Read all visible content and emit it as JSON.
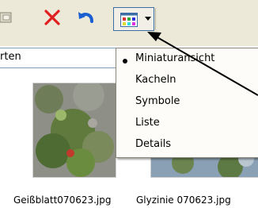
{
  "toolbar": {
    "icons": [
      "copy-to-icon",
      "delete-icon",
      "undo-icon",
      "views-icon"
    ]
  },
  "address": {
    "text": "rten"
  },
  "menu": {
    "items": [
      "Miniaturansicht",
      "Kacheln",
      "Symbole",
      "Liste",
      "Details"
    ],
    "selected": "Miniaturansicht"
  },
  "files": [
    {
      "name": "Geißblatt070623.jpg"
    },
    {
      "name": "Glyzinie 070623.jpg"
    }
  ],
  "colors": {
    "delete": "#e02020",
    "undo": "#1a5fd1",
    "accent": "#3a6ea5",
    "toolbar_bg": "#ece9d8"
  }
}
